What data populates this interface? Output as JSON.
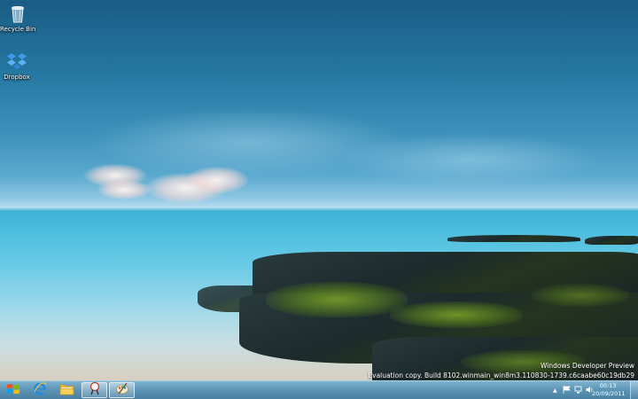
{
  "desktop": {
    "icons": [
      {
        "label": "Recycle Bin",
        "icon": "recycle-bin-icon"
      },
      {
        "label": "Dropbox",
        "icon": "dropbox-icon"
      }
    ],
    "watermark": {
      "line1": "Windows Developer Preview",
      "line2": "Evaluation copy. Build 8102.winmain_win8m3.110830-1739.c6caabe60c19db29"
    }
  },
  "taskbar": {
    "start_icon": "windows-logo-icon",
    "pinned": [
      {
        "name": "internet-explorer",
        "icon": "internet-explorer-icon"
      },
      {
        "name": "windows-explorer",
        "icon": "folder-icon"
      },
      {
        "name": "snipping-tool",
        "icon": "snipping-tool-icon"
      },
      {
        "name": "paint",
        "icon": "paint-icon"
      }
    ],
    "tray": {
      "show_hidden": "▲",
      "clock_time": "00:13",
      "clock_date": "20/09/2011"
    }
  }
}
